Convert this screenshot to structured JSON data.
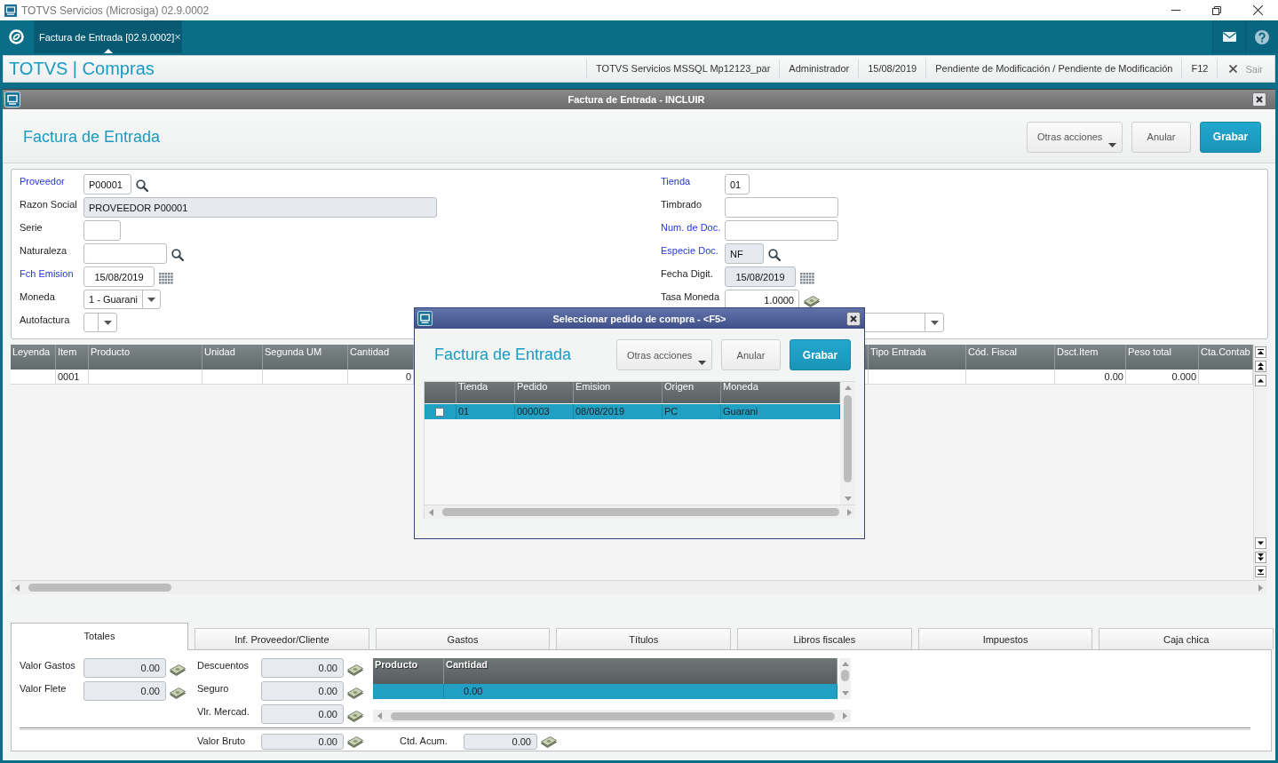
{
  "window": {
    "title": "TOTVS Servicios (Microsiga) 02.9.0002"
  },
  "app_bar": {
    "tabs": [
      {
        "label": "Factura de Entrada [02.9.0002]",
        "selected": true,
        "close": "×"
      }
    ]
  },
  "header": {
    "brand": "TOTVS | Compras",
    "info": [
      "TOTVS Servicios MSSQL Mp12123_par",
      "Administrador",
      "15/08/2019",
      "Pendiente de Modificación / Pendiente de Modificación",
      "F12"
    ],
    "exit": "Sair"
  },
  "dialog": {
    "title": "Factura de Entrada - INCLUIR",
    "heading": "Factura de Entrada",
    "buttons": [
      {
        "label": "Otras acciones",
        "kind": "menu"
      },
      {
        "label": "Anular",
        "kind": "plain"
      },
      {
        "label": "Grabar",
        "kind": "primary"
      }
    ]
  },
  "form": {
    "left": [
      {
        "label": "Proveedor",
        "required": true,
        "kind": "lookup",
        "value": "P00001",
        "disabled": false
      },
      {
        "label": "Razon Social",
        "required": false,
        "kind": "text",
        "value": "PROVEEDOR P00001",
        "disabled": true
      },
      {
        "label": "Serie",
        "required": false,
        "kind": "text",
        "disabled": false
      },
      {
        "label": "Naturaleza",
        "required": false,
        "kind": "lookup",
        "disabled": false
      },
      {
        "label": "Fch Emision",
        "required": true,
        "kind": "date",
        "value": "15/08/2019",
        "disabled": false
      },
      {
        "label": "Moneda",
        "required": false,
        "kind": "select",
        "value": "1 - Guarani",
        "disabled": false
      },
      {
        "label": "Autofactura",
        "required": false,
        "kind": "select",
        "disabled": false
      }
    ],
    "right": [
      {
        "label": "Tienda",
        "required": true,
        "kind": "text",
        "value": "01",
        "disabled": false
      },
      {
        "label": "Timbrado",
        "required": false,
        "kind": "text",
        "disabled": false
      },
      {
        "label": "Num. de Doc.",
        "required": true,
        "kind": "text",
        "disabled": false
      },
      {
        "label": "Especie Doc.",
        "required": true,
        "kind": "lookup",
        "value": "NF",
        "disabled": true
      },
      {
        "label": "Fecha Digit.",
        "required": false,
        "kind": "date",
        "value": "15/08/2019",
        "disabled": true
      },
      {
        "label": "Tasa Moneda",
        "required": false,
        "kind": "amount",
        "value": "1.0000",
        "disabled": false
      },
      {
        "kind": "select",
        "disabled": false
      }
    ]
  },
  "items_grid": {
    "columns": [
      "Leyenda",
      "Item",
      "Producto",
      "Unidad",
      "Segunda UM",
      "Cantidad",
      "Tipo Entrada",
      "Cód. Fiscal",
      "Dsct.Item",
      "Peso total",
      "Cta.Contab"
    ],
    "rows": [
      {
        "cells": [
          null,
          "0001",
          null,
          null,
          null,
          "0",
          null,
          null,
          "0.00",
          "0.000",
          null
        ]
      }
    ]
  },
  "tabs": [
    {
      "label": "Totales",
      "selected": true
    },
    {
      "label": "Inf. Proveedor/Cliente",
      "selected": false
    },
    {
      "label": "Gastos",
      "selected": false
    },
    {
      "label": "Títulos",
      "selected": false
    },
    {
      "label": "Libros fiscales",
      "selected": false
    },
    {
      "label": "Impuestos",
      "selected": false
    },
    {
      "label": "Caja chica",
      "selected": false
    }
  ],
  "totals": {
    "left": [
      {
        "label": "Valor Gastos",
        "value": "0.00"
      },
      {
        "label": "Valor Flete",
        "value": "0.00"
      }
    ],
    "middle": [
      {
        "label": "Descuentos",
        "value": "0.00"
      },
      {
        "label": "Seguro",
        "value": "0.00"
      },
      {
        "label": "Vlr. Mercad.",
        "value": "0.00"
      }
    ],
    "grid": {
      "columns": [
        "Producto",
        "Cantidad"
      ],
      "rows": [
        {
          "selected": true,
          "cells": [
            null,
            "0.00"
          ]
        }
      ]
    },
    "footer": [
      {
        "label": "Valor Bruto",
        "value": "0.00"
      },
      {
        "label": "Ctd. Acum.",
        "value": "0.00"
      }
    ]
  },
  "order_dialog": {
    "title": "Seleccionar pedido de compra - <F5>",
    "heading": "Factura de Entrada",
    "buttons": [
      {
        "label": "Otras acciones",
        "kind": "menu"
      },
      {
        "label": "Anular",
        "kind": "plain"
      },
      {
        "label": "Grabar",
        "kind": "primary"
      }
    ],
    "columns": [
      "Tienda",
      "Pedido",
      "Emision",
      "Origen",
      "Moneda"
    ],
    "rows": [
      {
        "selected": true,
        "checked": false,
        "cells": [
          "01",
          "000003",
          "08/08/2019",
          "PC",
          "Guarani"
        ]
      }
    ]
  }
}
